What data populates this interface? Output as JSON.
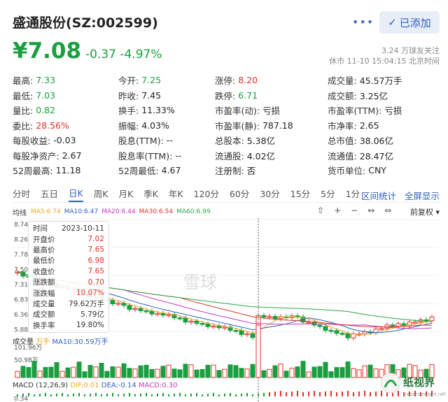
{
  "header": {
    "stock_name": "盛通股份(SZ:002599)",
    "more": "•••",
    "added_label": "已添加",
    "price": "¥7.08",
    "change": "-0.37  -4.97%",
    "followers": "3.24 万球友关注",
    "status": "休市 11-10 15:04:15 北京时间"
  },
  "stats": [
    [
      [
        "最高:",
        "7.33",
        "green"
      ],
      [
        "今开:",
        "7.25",
        "green"
      ],
      [
        "涨停:",
        "8.20",
        "red"
      ],
      [
        "成交量:",
        "45.57万手",
        ""
      ]
    ],
    [
      [
        "最低:",
        "7.03",
        "green"
      ],
      [
        "昨收:",
        "7.45",
        ""
      ],
      [
        "跌停:",
        "6.71",
        "green"
      ],
      [
        "成交额:",
        "3.25亿",
        ""
      ]
    ],
    [
      [
        "量比:",
        "0.82",
        "green"
      ],
      [
        "换手:",
        "11.33%",
        ""
      ],
      [
        "市盈率(动):",
        "亏损",
        ""
      ],
      [
        "市盈率(TTM):",
        "亏损",
        ""
      ]
    ],
    [
      [
        "委比:",
        "28.56%",
        "red"
      ],
      [
        "振幅:",
        "4.03%",
        ""
      ],
      [
        "市盈率(静):",
        "787.18",
        ""
      ],
      [
        "市净率:",
        "2.65",
        ""
      ]
    ],
    [
      [
        "每股收益:",
        "-0.03",
        ""
      ],
      [
        "股息(TTM):",
        "--",
        ""
      ],
      [
        "总股本:",
        "5.38亿",
        ""
      ],
      [
        "总市值:",
        "38.06亿",
        ""
      ]
    ],
    [
      [
        "每股净资产:",
        "2.67",
        ""
      ],
      [
        "股息率(TTM):",
        "--",
        ""
      ],
      [
        "流通股:",
        "4.02亿",
        ""
      ],
      [
        "流通值:",
        "28.47亿",
        ""
      ]
    ],
    [
      [
        "52周最高:",
        "11.18",
        ""
      ],
      [
        "52周最低:",
        "4.67",
        ""
      ],
      [
        "注册制:",
        "否",
        ""
      ],
      [
        "货币单位:",
        "CNY",
        ""
      ]
    ]
  ],
  "tabs": [
    "分时",
    "五日",
    "日K",
    "周K",
    "月K",
    "季K",
    "年K",
    "120分",
    "60分",
    "30分",
    "15分",
    "5分",
    "1分"
  ],
  "active_tab": "日K",
  "tab_right": [
    "区间统计",
    "全屏显示"
  ],
  "ma_row": {
    "label": "均线",
    "items": [
      {
        "text": "MA5:6.74",
        "color": "#f5a623"
      },
      {
        "text": "MA10:6.47",
        "color": "#2f5fc0"
      },
      {
        "text": "MA20:6.44",
        "color": "#c23ac2"
      },
      {
        "text": "MA30:6.54",
        "color": "#e0332a"
      },
      {
        "text": "MA60:6.99",
        "color": "#2aa84a"
      }
    ]
  },
  "tools": [
    "⇧",
    "+",
    "−",
    "↔",
    "⇔"
  ],
  "fq_label": "前复权",
  "price_axis": [
    "8.74",
    "8.26",
    "7.78",
    "7.50",
    "7.31",
    "6.83",
    "6.36",
    "5.88"
  ],
  "tooltip": [
    {
      "k": "时间",
      "v": "2023-10-11",
      "color": ""
    },
    {
      "k": "开盘价",
      "v": "7.02",
      "color": "red"
    },
    {
      "k": "最高价",
      "v": "7.65",
      "color": "red"
    },
    {
      "k": "最低价",
      "v": "6.98",
      "color": "red"
    },
    {
      "k": "收盘价",
      "v": "7.65",
      "color": "red"
    },
    {
      "k": "涨跌额",
      "v": "0.70",
      "color": "red"
    },
    {
      "k": "涨跌幅",
      "v": "10.07%",
      "color": "red"
    },
    {
      "k": "成交量",
      "v": "79.62万手",
      "color": ""
    },
    {
      "k": "成交额",
      "v": "5.79亿",
      "color": ""
    },
    {
      "k": "换手率",
      "v": "19.80%",
      "color": ""
    }
  ],
  "volume": {
    "label_prefix": "成交量",
    "ma5": "万手",
    "ma10": "MA10:30.59万手",
    "axis": [
      "101.96万",
      "50.98万"
    ]
  },
  "macd": {
    "label": "MACD (12,26,9)",
    "dif": "DIF:0.01",
    "dea": "DEA:-0.14",
    "macd": "MACD:0.30",
    "axis": "0.34"
  },
  "watermark": "雪球",
  "corner": "纸视界",
  "corner_url": "papersinsight.net",
  "colors": {
    "up": "#e0332a",
    "down": "#1a9e3f",
    "accent": "#2f5fc0"
  }
}
